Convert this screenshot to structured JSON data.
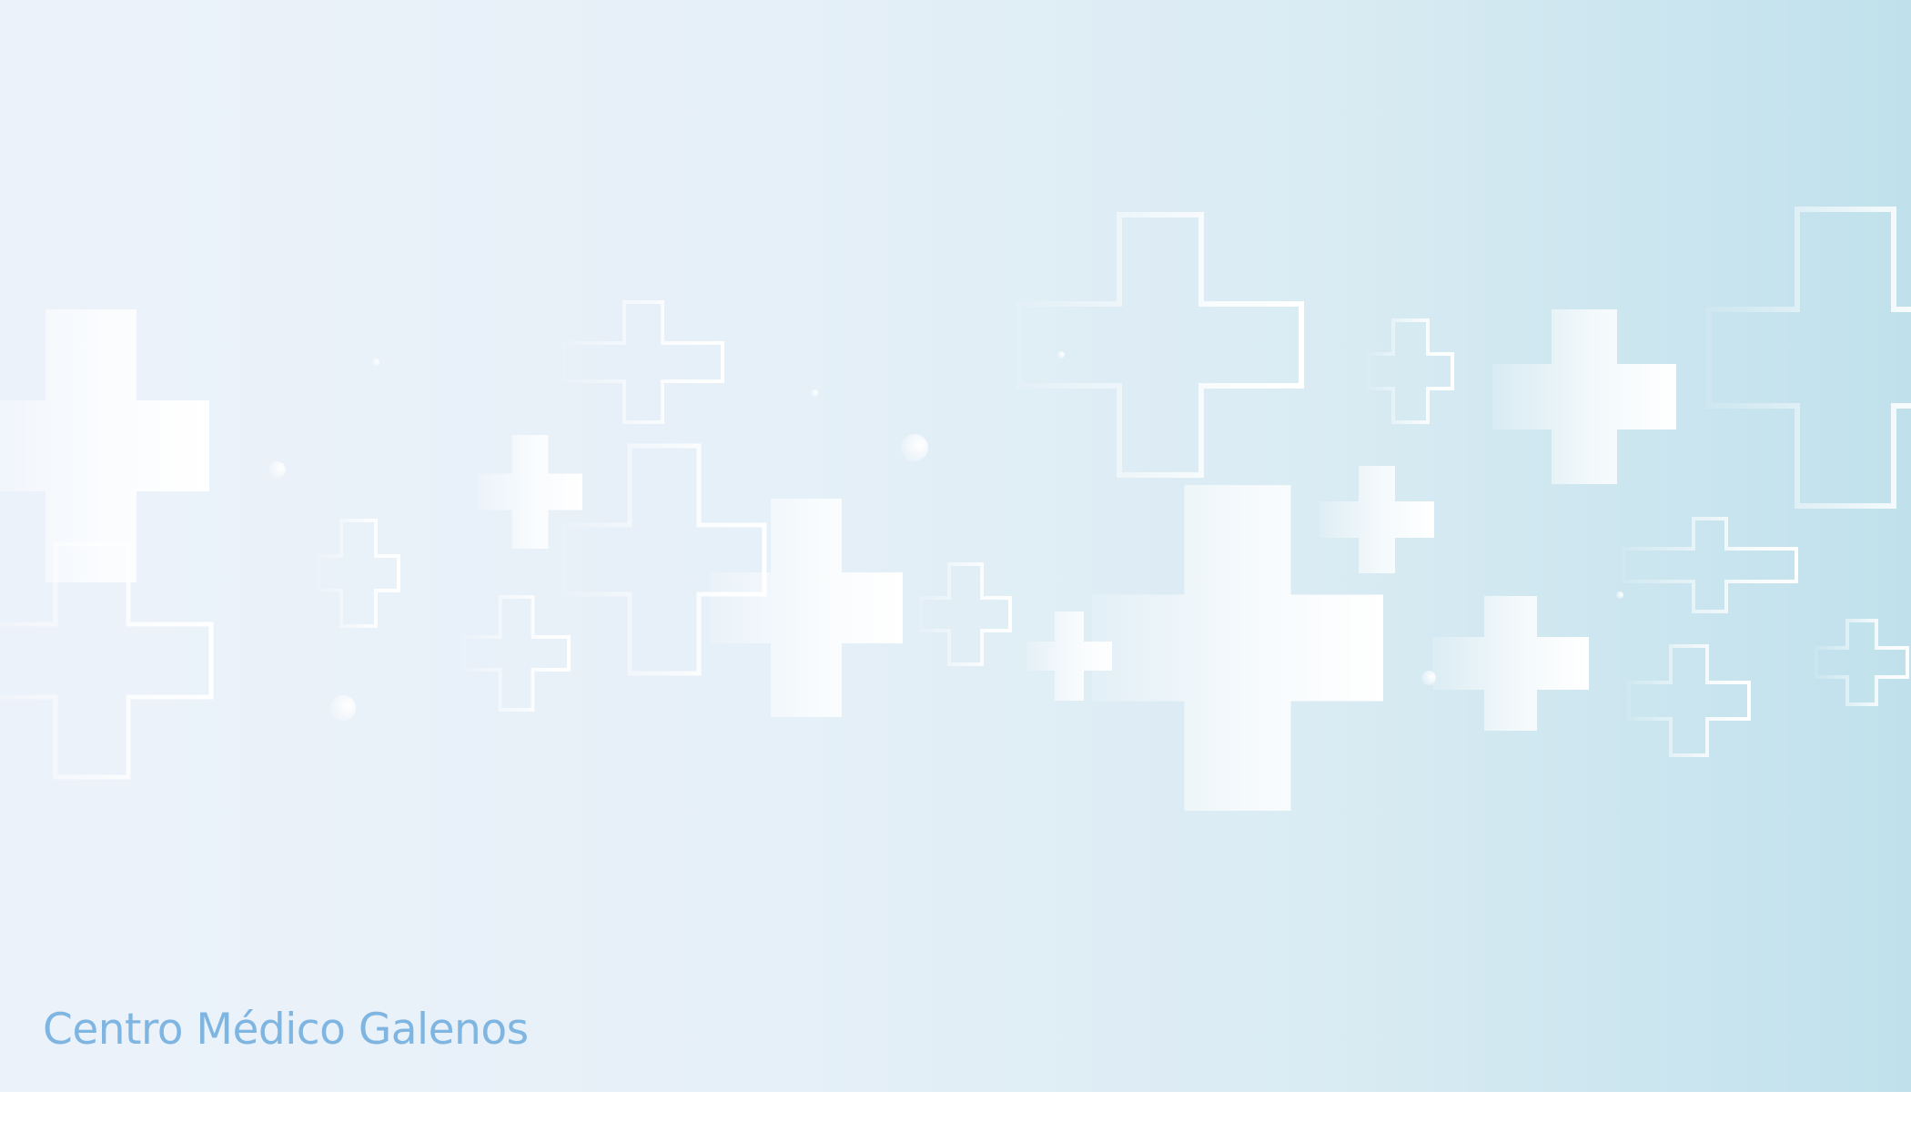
{
  "caption": {
    "text": "Centro Médico Galenos"
  },
  "colors": {
    "caption": "#7fb5e1",
    "background_left": "#ecf2fa",
    "background_right": "#c0e1ec",
    "grid_left": "#dbe6f2",
    "grid_right": "#9fcfe2",
    "cross_fill": "#ffffff",
    "footer": "#ffffff"
  },
  "icons": [
    "medical-cross-icon"
  ]
}
